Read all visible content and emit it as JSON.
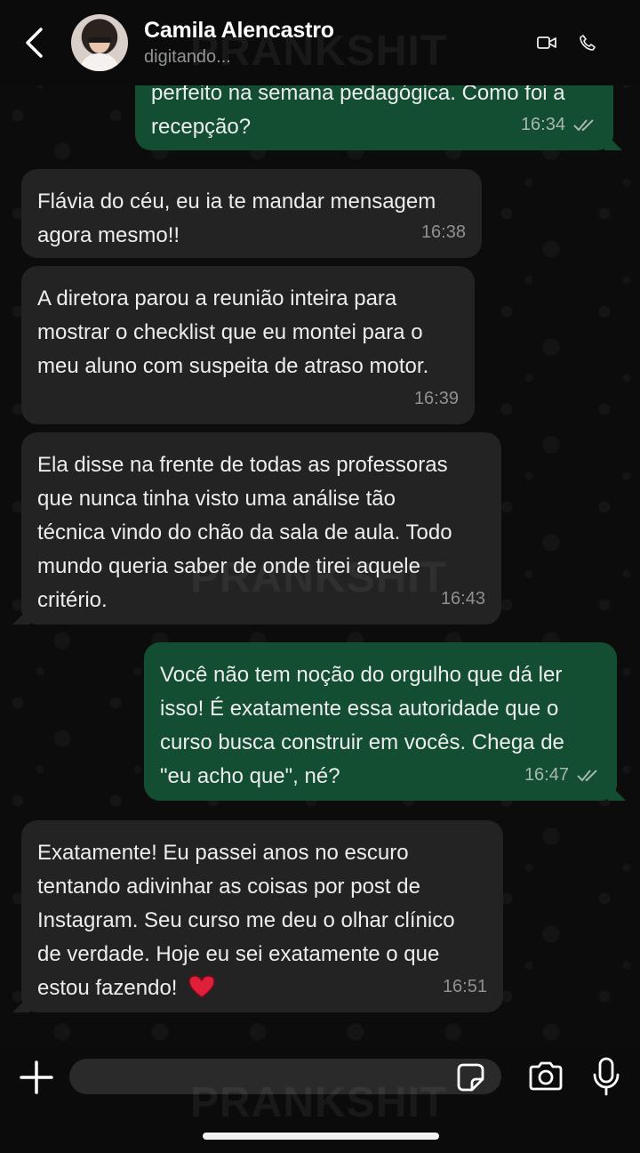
{
  "header": {
    "contact_name": "Camila Alencastro",
    "status": "digitando...",
    "icons": [
      "back-arrow-icon",
      "avatar",
      "video-call-icon",
      "phone-icon"
    ]
  },
  "watermark": "PRANKSHIT",
  "messages": [
    {
      "direction": "out",
      "lines": [
        "perfeito na semana pedagógica. Como foi a",
        "recepção?"
      ],
      "time": "16:34",
      "read": true
    },
    {
      "direction": "in",
      "lines": [
        "Flávia do céu, eu ia te mandar mensagem",
        "agora mesmo!!"
      ],
      "time": "16:38"
    },
    {
      "direction": "in",
      "lines": [
        "A diretora parou a reunião inteira para",
        "mostrar o checklist que eu montei para o",
        "meu aluno com suspeita de atraso motor."
      ],
      "time": "16:39"
    },
    {
      "direction": "in",
      "lines": [
        "Ela disse na frente de todas as professoras",
        "que nunca tinha visto uma análise tão",
        "técnica vindo do chão da sala de aula. Todo",
        "mundo queria saber de onde tirei aquele",
        "critério."
      ],
      "time": "16:43"
    },
    {
      "direction": "out",
      "lines": [
        "Você não tem noção do orgulho que dá ler",
        "isso! É exatamente essa autoridade que o",
        "curso busca construir em vocês. Chega de",
        "\"eu acho que\", né?"
      ],
      "time": "16:47",
      "read": true
    },
    {
      "direction": "in",
      "lines": [
        "Exatamente! Eu passei anos no escuro",
        "tentando adivinhar as coisas por post de",
        "Instagram. Seu curso me deu o olhar clínico",
        "de verdade. Hoje eu sei exatamente o que",
        "estou fazendo!"
      ],
      "time": "16:51",
      "emoji": "heart-emoji"
    }
  ],
  "composer": {
    "input_value": "",
    "icons": [
      "plus-icon",
      "sticker-icon",
      "camera-icon",
      "microphone-icon"
    ]
  },
  "colors": {
    "incoming_bubble": "#232323",
    "outgoing_bubble": "#134d32",
    "background": "#0c0c0c",
    "read_ticks": "#a7b8ae"
  }
}
